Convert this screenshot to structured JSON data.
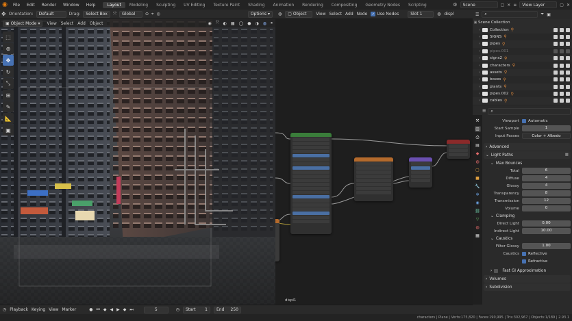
{
  "topbar": {
    "menus": [
      "File",
      "Edit",
      "Render",
      "Window",
      "Help"
    ],
    "workspaces": [
      "Layout",
      "Modeling",
      "Sculpting",
      "UV Editing",
      "Texture Paint",
      "Shading",
      "Animation",
      "Rendering",
      "Compositing",
      "Geometry Nodes",
      "Scripting"
    ],
    "active_workspace": "Layout",
    "scene": "Scene",
    "view_layer": "View Layer"
  },
  "toolsettings": {
    "orientation_label": "Orientation:",
    "orientation_value": "Default",
    "drag_label": "Drag:",
    "drag_value": "Select Box",
    "transform_value": "Global",
    "options_label": "Options"
  },
  "viewport": {
    "mode": "Object Mode",
    "menus": [
      "View",
      "Select",
      "Add",
      "Object"
    ]
  },
  "node_editor": {
    "type": "Object",
    "menus": [
      "View",
      "Select",
      "Add",
      "Node"
    ],
    "use_nodes_label": "Use Nodes",
    "slot": "Slot 1",
    "material": "displ",
    "material_label": "displ1"
  },
  "outliner": {
    "root": "Scene Collection",
    "items": [
      {
        "name": "Collection",
        "dim": false
      },
      {
        "name": "SIGNS",
        "dim": false
      },
      {
        "name": "pipes",
        "dim": false
      },
      {
        "name": "pipes.001",
        "dim": true
      },
      {
        "name": "signs2",
        "dim": false
      },
      {
        "name": "characters",
        "dim": false
      },
      {
        "name": "assets",
        "dim": false
      },
      {
        "name": "boxes",
        "dim": false
      },
      {
        "name": "plants",
        "dim": false
      },
      {
        "name": "pipes.002",
        "dim": false
      },
      {
        "name": "cables",
        "dim": false
      }
    ]
  },
  "properties": {
    "viewport_label": "Viewport",
    "viewport_value": "Automatic",
    "start_sample_label": "Start Sample",
    "start_sample_value": "1",
    "input_passes_label": "Input Passes",
    "input_passes_value": "Color + Albedo",
    "advanced": "Advanced",
    "light_paths": "Light Paths",
    "max_bounces": "Max Bounces",
    "bounces": [
      {
        "label": "Total",
        "value": "6"
      },
      {
        "label": "Diffuse",
        "value": "4"
      },
      {
        "label": "Glossy",
        "value": "4"
      },
      {
        "label": "Transparency",
        "value": "8"
      },
      {
        "label": "Transmission",
        "value": "12"
      },
      {
        "label": "Volume",
        "value": "0"
      }
    ],
    "clamping": "Clamping",
    "direct_light_label": "Direct Light",
    "direct_light_value": "0.00",
    "indirect_light_label": "Indirect Light",
    "indirect_light_value": "10.00",
    "caustics": "Caustics",
    "filter_glossy_label": "Filter Glossy",
    "filter_glossy_value": "1.00",
    "caustics_label": "Caustics",
    "reflective": "Reflective",
    "refractive": "Refractive",
    "fast_gi": "Fast GI Approximation",
    "volumes": "Volumes",
    "subdivision": "Subdivision"
  },
  "timeline": {
    "menus": [
      "Playback",
      "Keying",
      "View",
      "Marker"
    ],
    "current_frame": "5",
    "start_label": "Start",
    "start_value": "1",
    "end_label": "End",
    "end_value": "250"
  },
  "status": {
    "text": "characters | Plane | Verts:175,820 | Faces:190,995 | Tris:302,967 | Objects:1/189 | 2.93.1"
  },
  "colors": {
    "accent": "#4772b3",
    "node_shader_header": "#3a7d3a",
    "node_color_header": "#b46a2c",
    "node_vector_header": "#6a4fb0",
    "node_output_header": "#8b2a2a"
  }
}
